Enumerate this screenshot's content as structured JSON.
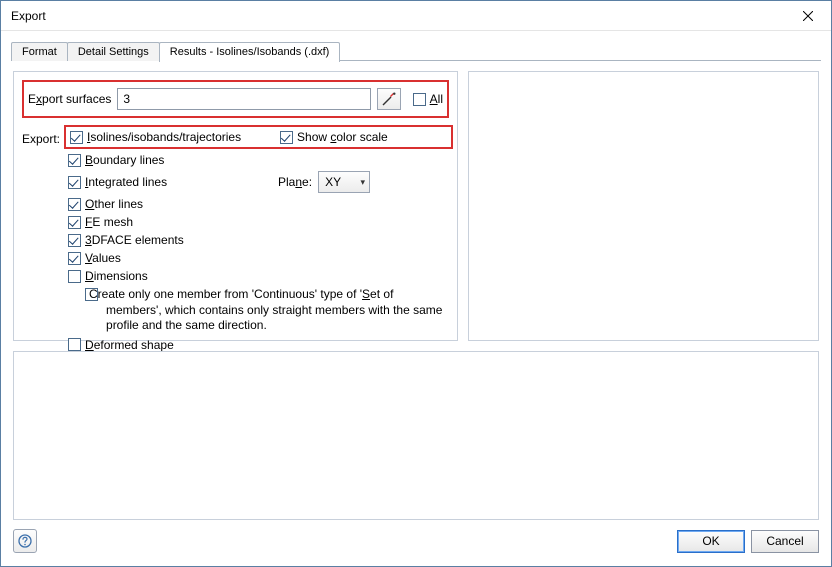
{
  "window": {
    "title": "Export"
  },
  "tabs": {
    "format": "Format",
    "detail": "Detail Settings",
    "results": "Results - Isolines/Isobands (.dxf)"
  },
  "surfaces": {
    "label_pre": "E",
    "label_mn": "x",
    "label_post": "port surfaces",
    "value": "3",
    "all_mn": "A",
    "all_post": "ll"
  },
  "export": {
    "label": "Export:",
    "isolines_mn": "I",
    "isolines_post": "solines/isobands/trajectories",
    "show_color_pre": "Show ",
    "show_color_mn": "c",
    "show_color_post": "olor scale",
    "boundary_mn": "B",
    "boundary_post": "oundary lines",
    "integrated_mn": "I",
    "integrated_post": "ntegrated lines",
    "plane_pre": "Pla",
    "plane_mn": "n",
    "plane_post": "e:",
    "plane_value": "XY",
    "other_mn": "O",
    "other_post": "ther lines",
    "fe_mn": "F",
    "fe_post": "E mesh",
    "face3d_pre": "",
    "face3d_mn": "3",
    "face3d_post": "DFACE elements",
    "values_mn": "V",
    "values_post": "alues",
    "dimensions_mn": "D",
    "dimensions_post": "imensions",
    "continuous_pre": "Create only one member from 'Continuous' type of '",
    "continuous_mn": "S",
    "continuous_post": "et of members', which contains only straight members with the same profile and the same direction.",
    "deformed_mn": "D",
    "deformed_post": "eformed shape"
  },
  "buttons": {
    "ok": "OK",
    "cancel": "Cancel"
  },
  "icons": {
    "close": "close",
    "picker": "picker",
    "help": "help"
  }
}
